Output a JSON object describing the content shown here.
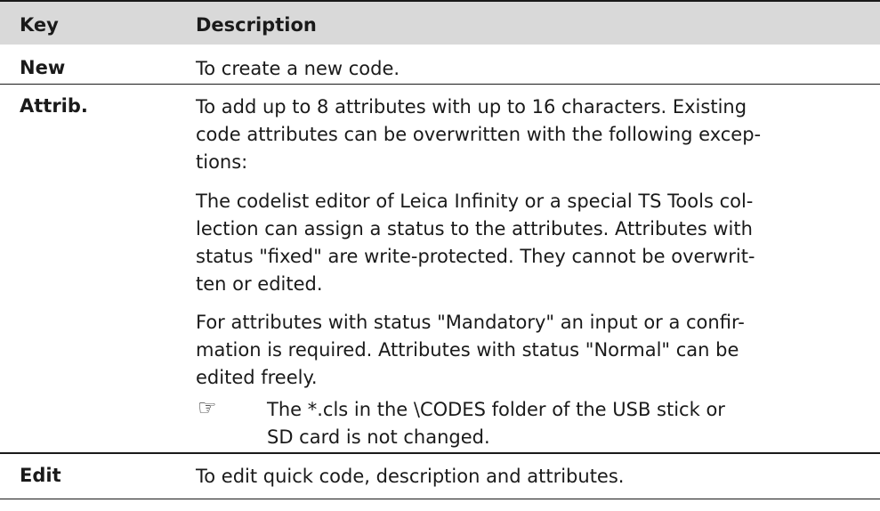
{
  "header": {
    "key": "Key",
    "description": "Description"
  },
  "rows": [
    {
      "key": "New",
      "description": "To create a new code."
    },
    {
      "key": "Attrib.",
      "paragraphs": [
        "To add up to 8 attributes with up to 16 characters. Existing\ncode attributes can be overwritten with the following excep-\ntions:",
        "The codelist editor of Leica Infinity or a special TS Tools col-\nlection can assign a status to the attributes. Attributes with\nstatus \"fixed\" are write-protected. They cannot be overwrit-\nten or edited.",
        "For attributes with status \"Mandatory\" an input or a confir-\nmation is required. Attributes with status \"Normal\" can be\nedited freely."
      ],
      "note": "The *.cls in the \\CODES folder of the USB stick or\nSD card is not changed."
    },
    {
      "key": "Edit",
      "description": "To edit quick code, description and attributes."
    }
  ],
  "icons": {
    "note": "hand-pointing-icon"
  }
}
